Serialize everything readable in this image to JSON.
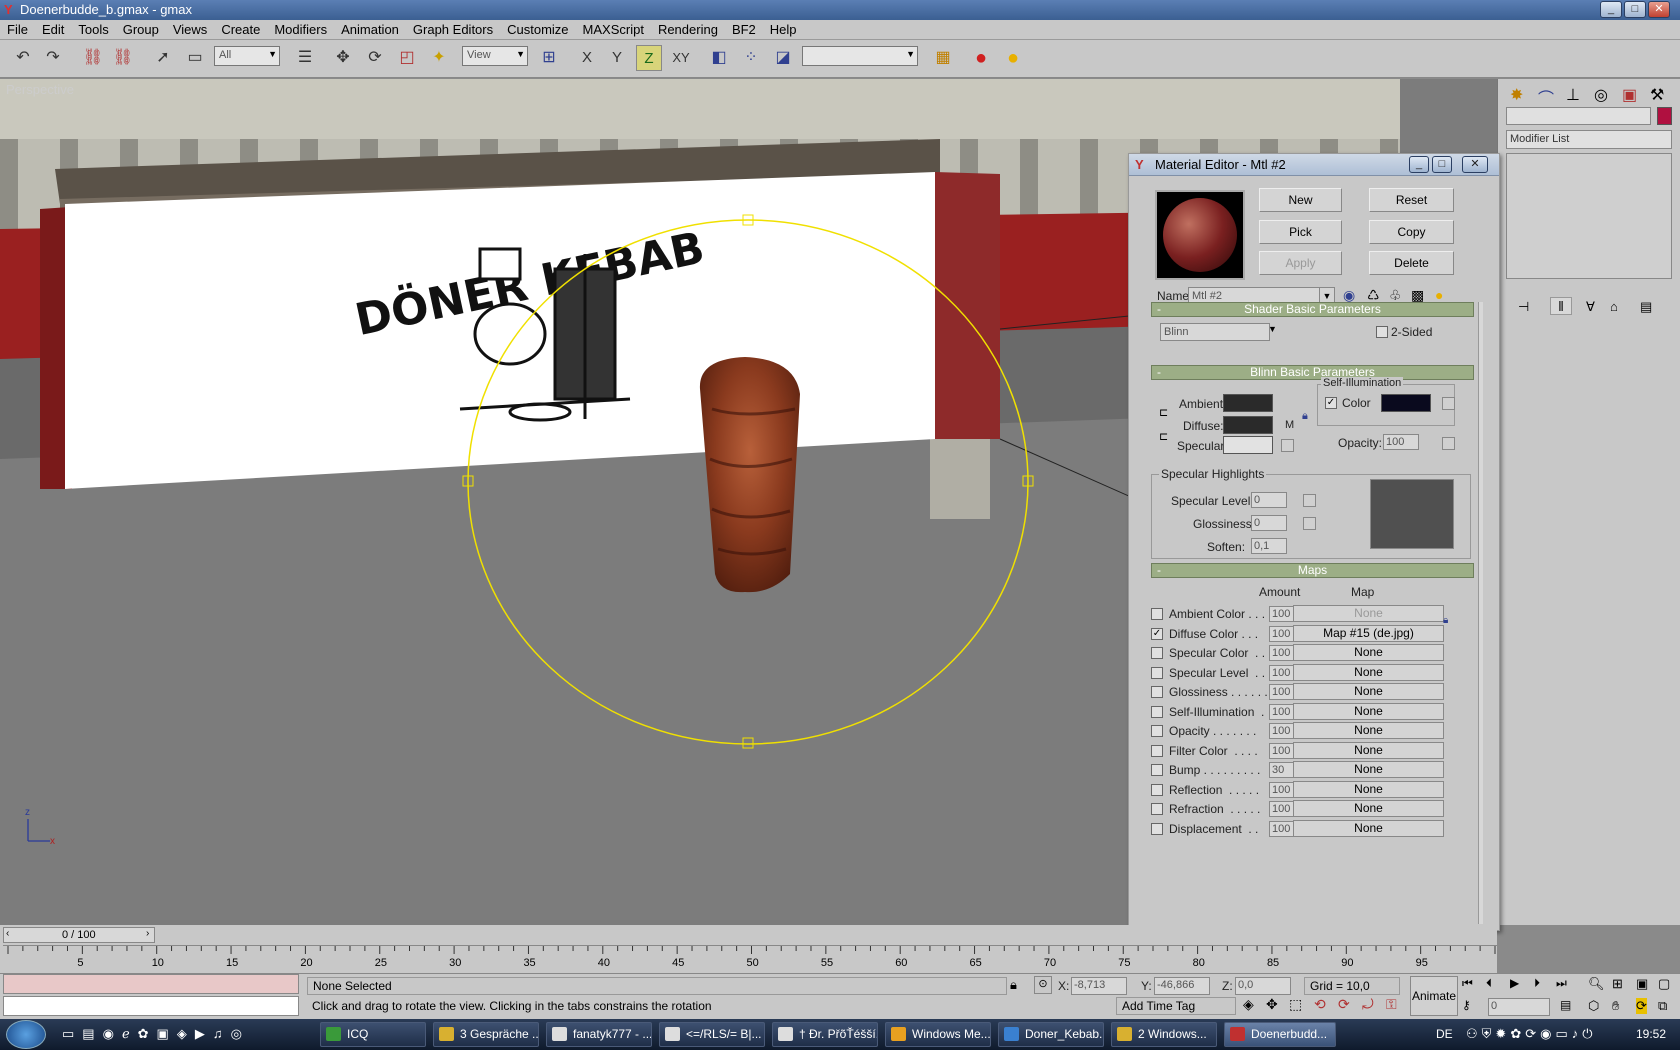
{
  "window": {
    "title": "Doenerbudde_b.gmax - gmax",
    "min": "_",
    "max": "□",
    "close": "✕"
  },
  "menu": [
    "File",
    "Edit",
    "Tools",
    "Group",
    "Views",
    "Create",
    "Modifiers",
    "Animation",
    "Graph Editors",
    "Customize",
    "MAXScript",
    "Rendering",
    "BF2",
    "Help"
  ],
  "toolbar": {
    "selection_filter": "All",
    "ref_coord": "View",
    "named_sel": "",
    "axis_x": "X",
    "axis_y": "Y",
    "axis_z": "Z",
    "axis_xy": "XY"
  },
  "viewport": {
    "label": "Perspective",
    "sign_text": "DÖNER KEBAB"
  },
  "command_panel": {
    "modifier_list": "Modifier List"
  },
  "material_editor": {
    "title": "Material Editor - Mtl #2",
    "buttons": {
      "new": "New",
      "reset": "Reset",
      "pick": "Pick",
      "copy": "Copy",
      "apply": "Apply",
      "delete": "Delete"
    },
    "name_label": "Name",
    "name_value": "Mtl #2",
    "shader": {
      "rollout": "Shader Basic Parameters",
      "shader_type": "Blinn",
      "two_sided": "2-Sided"
    },
    "blinn": {
      "rollout": "Blinn Basic Parameters",
      "ambient": "Ambient:",
      "diffuse": "Diffuse:",
      "specular": "Specular:",
      "m": "M",
      "self_illum": "Self-Illumination",
      "color": "Color",
      "opacity_label": "Opacity:",
      "opacity_value": "100",
      "colors": {
        "ambient": "#2a2a2a",
        "diffuse": "#2a2a2a",
        "specular": "#e2e2e2",
        "self_illum": "#0a0a1e"
      }
    },
    "highlights": {
      "title": "Specular Highlights",
      "spec_level": "Specular Level:",
      "spec_level_value": "0",
      "glossiness": "Glossiness:",
      "glossiness_value": "0",
      "soften": "Soften:",
      "soften_value": "0,1"
    },
    "maps": {
      "rollout": "Maps",
      "amount_header": "Amount",
      "map_header": "Map",
      "rows": [
        {
          "label": "Ambient Color . . .",
          "amount": "100",
          "map": "None",
          "checked": false
        },
        {
          "label": "Diffuse Color . . .",
          "amount": "100",
          "map": "Map #15 (de.jpg)",
          "checked": true
        },
        {
          "label": "Specular Color  . .",
          "amount": "100",
          "map": "None",
          "checked": false
        },
        {
          "label": "Specular Level  . .",
          "amount": "100",
          "map": "None",
          "checked": false
        },
        {
          "label": "Glossiness . . . . . .",
          "amount": "100",
          "map": "None",
          "checked": false
        },
        {
          "label": "Self-Illumination  .",
          "amount": "100",
          "map": "None",
          "checked": false
        },
        {
          "label": "Opacity . . . . . . .",
          "amount": "100",
          "map": "None",
          "checked": false
        },
        {
          "label": "Filter Color  . . . .",
          "amount": "100",
          "map": "None",
          "checked": false
        },
        {
          "label": "Bump . . . . . . . . .",
          "amount": "30",
          "map": "None",
          "checked": false
        },
        {
          "label": "Reflection  . . . . .",
          "amount": "100",
          "map": "None",
          "checked": false
        },
        {
          "label": "Refraction  . . . . .",
          "amount": "100",
          "map": "None",
          "checked": false
        },
        {
          "label": "Displacement  . .",
          "amount": "100",
          "map": "None",
          "checked": false
        }
      ]
    }
  },
  "timeline": {
    "frame": "0 / 100",
    "ticks": [
      "5",
      "10",
      "15",
      "20",
      "25",
      "30",
      "35",
      "40",
      "45",
      "50",
      "55",
      "60",
      "65",
      "70",
      "75",
      "80",
      "85",
      "90",
      "95"
    ]
  },
  "status": {
    "selection": "None Selected",
    "prompt": "Click and drag to rotate the view.  Clicking in the tabs constrains the rotation",
    "x_label": "X:",
    "x": "-8,713",
    "y_label": "Y:",
    "y": "-46,866",
    "z_label": "Z:",
    "z": "0,0",
    "grid": "Grid = 10,0",
    "add_time_tag": "Add Time Tag",
    "animate": "Animate",
    "frame_field": "0"
  },
  "taskbar": {
    "items": [
      "ICQ",
      "3 Gespräche ...",
      "fanatyk777 - ...",
      "<=/RLS/= B|...",
      "† Ðr. PřõŤéšší...",
      "Windows Me...",
      "Doner_Kebab...",
      "2 Windows...",
      "Doenerbudd..."
    ],
    "lang": "DE",
    "clock": "19:52"
  }
}
